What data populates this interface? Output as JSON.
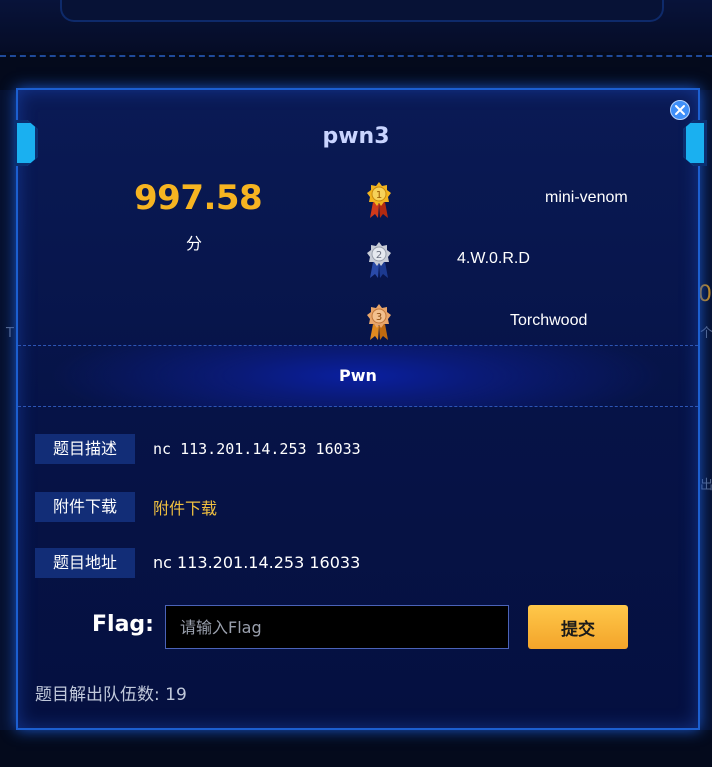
{
  "background": {
    "left_peek": "T",
    "right_peek_number": "0",
    "right_peek_char": "个",
    "right_peek_char2": "出"
  },
  "challenge": {
    "title": "pwn3",
    "score": "997.58",
    "score_unit": "分",
    "category": "Pwn"
  },
  "ranking": [
    {
      "rank": "1",
      "team": "mini-venom",
      "medal": "gold-medal-icon"
    },
    {
      "rank": "2",
      "team": "4.W.0.R.D",
      "medal": "silver-medal-icon"
    },
    {
      "rank": "3",
      "team": "Torchwood",
      "medal": "bronze-medal-icon"
    }
  ],
  "details": {
    "description_label": "题目描述",
    "description_value": "nc 113.201.14.253 16033",
    "attachment_label": "附件下载",
    "attachment_link": "附件下载",
    "address_label": "题目地址",
    "address_value": "nc 113.201.14.253 16033"
  },
  "flag_form": {
    "label": "Flag:",
    "placeholder": "请输入Flag",
    "value": "",
    "submit_label": "提交"
  },
  "solve_info": {
    "label": "题目解出队伍数:",
    "count": "19"
  },
  "colors": {
    "accent_gold": "#f6b421",
    "border_blue": "#1c5fd0",
    "submit_gold": "#ffc84a"
  }
}
